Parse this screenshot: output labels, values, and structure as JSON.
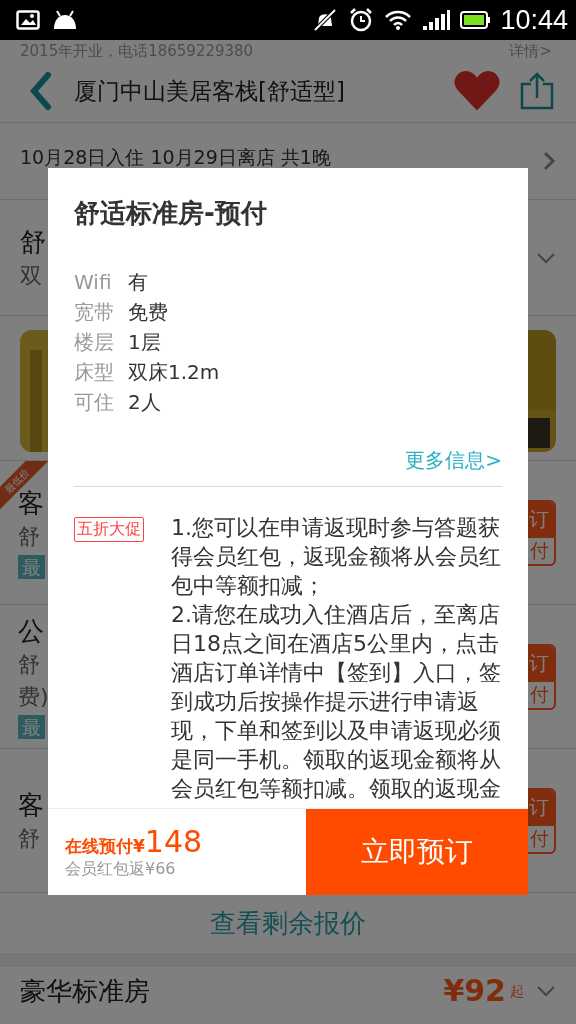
{
  "status_bar": {
    "time": "10:44"
  },
  "header": {
    "subtitle": "2015年开业，电话18659229380",
    "details_link": "详情>",
    "title": "厦门中山美居客栈[舒适型]",
    "favorite": true
  },
  "stay_dates": "10月28日入住  10月29日离店  共1晚",
  "room_group": {
    "name": "舒",
    "detail": "双"
  },
  "offers": [
    {
      "ribbon": "最低价",
      "lines": [
        "客",
        "舒"
      ],
      "tag": "最",
      "button_top": "订",
      "button_bottom": "付"
    },
    {
      "lines": [
        "公",
        "舒",
        "费)"
      ],
      "tag": "最",
      "button_top": "订",
      "button_bottom": "付"
    },
    {
      "lines": [
        "客",
        "舒"
      ],
      "button_top": "订",
      "button_bottom": "付"
    }
  ],
  "more_quotes": "查看剩余报价",
  "next_room": {
    "name": "豪华标准房",
    "price": "¥92",
    "suffix": "起"
  },
  "dialog": {
    "title": "舒适标准房-预付",
    "facts": [
      {
        "label": "Wifi",
        "value": "有"
      },
      {
        "label": "宽带",
        "value": "免费"
      },
      {
        "label": "楼层",
        "value": "1层"
      },
      {
        "label": "床型",
        "value": "双床1.2m"
      },
      {
        "label": "可住",
        "value": "2人"
      }
    ],
    "more_link": "更多信息>",
    "promo": {
      "tag": "五折大促",
      "paragraphs": [
        "1.您可以在申请返现时参与答题获得会员红包，返现金额将从会员红包中等额扣减；",
        "2.请您在成功入住酒店后，至离店日18点之间在酒店5公里内，点击酒店订单详情中【签到】入口，签到成功后按操作提示进行申请返现，下单和签到以及申请返现必须是同一手机。领取的返现金额将从会员红包等额扣减。领取的返现金"
      ]
    },
    "footer": {
      "price_label": "在线预付¥",
      "price": "148",
      "rebate": "会员红包返¥66",
      "book_button": "立即预订"
    }
  }
}
